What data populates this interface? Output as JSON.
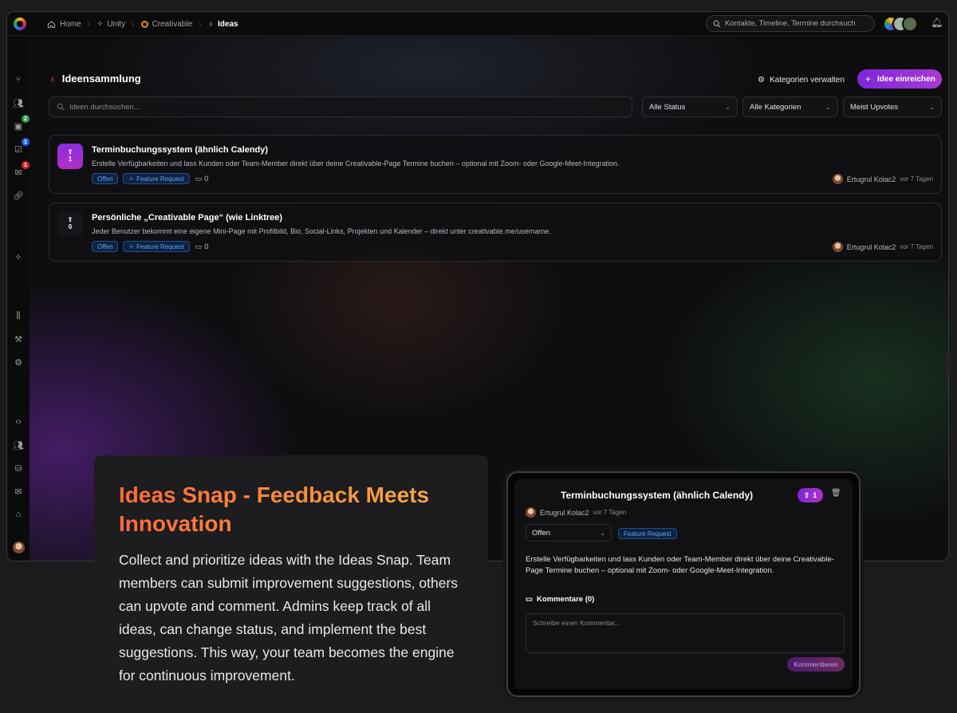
{
  "breadcrumb": {
    "home": "Home",
    "unity": "Unity",
    "creativable": "Creativable",
    "ideas": "Ideas"
  },
  "global_search": {
    "placeholder": "Kontakte, Timeline, Termine durchsuch"
  },
  "sidebar": {
    "badges": {
      "calendar": "2",
      "tasks": "1",
      "mail": "1"
    }
  },
  "page": {
    "title": "Ideensammlung",
    "manage_categories_label": "Kategorien verwalten",
    "submit_idea_label": "Idee einreichen",
    "search_placeholder": "Ideen durchsuchen...",
    "filters": {
      "status": "Alle Status",
      "category": "Alle Kategorien",
      "sort": "Meist Upvotes"
    }
  },
  "ideas": [
    {
      "title": "Terminbuchungssystem (ähnlich Calendy)",
      "description": "Erstelle Verfügbarkeiten und lass Kunden oder Team-Member direkt über deine Creativable-Page Termine buchen – optional mit Zoom- oder Google-Meet-Integration.",
      "upvotes": "1",
      "status": "Offen",
      "category": "Feature Request",
      "comments": "0",
      "author": "Ertugrul Kolac2",
      "time": "vor 7 Tagen"
    },
    {
      "title": "Persönliche „Creativable Page“ (wie Linktree)",
      "description": "Jeder Benutzer bekommt eine eigene Mini-Page mit Profilbild, Bio, Social-Links, Projekten und Kalender – direkt unter creativable.me/username.",
      "upvotes": "0",
      "status": "Offen",
      "category": "Feature Request",
      "comments": "0",
      "author": "Ertugrul Kolac2",
      "time": "vor 7 Tagen"
    }
  ],
  "promo": {
    "heading": "Ideas Snap - Feedback Meets Innovation",
    "body": "Collect and prioritize ideas with the Ideas Snap. Team members can submit improvement suggestions, others can upvote and comment. Admins keep track of all ideas, can change status, and implement the best suggestions. This way, your team becomes the engine for continuous improvement."
  },
  "detail": {
    "title": "Terminbuchungssystem (ähnlich Calendy)",
    "upvotes": "1",
    "author": "Ertugrul Kolac2",
    "time": "vor 7 Tagen",
    "status": "Offen",
    "category": "Feature Request",
    "description": "Erstelle Verfügbarkeiten und lass Kunden oder Team-Member direkt über deine Creativable-Page Termine buchen – optional mit Zoom- oder Google-Meet-Integration.",
    "comments_header": "Kommentare (0)",
    "comment_placeholder": "Schreibe einen Kommentar...",
    "comment_button": "Kommentieren"
  },
  "colors": {
    "accent": "#8a2ee0",
    "tag_blue": "#5fa3f5",
    "promo_gradient_start": "#ff6a3c",
    "promo_gradient_end": "#f0b040"
  }
}
